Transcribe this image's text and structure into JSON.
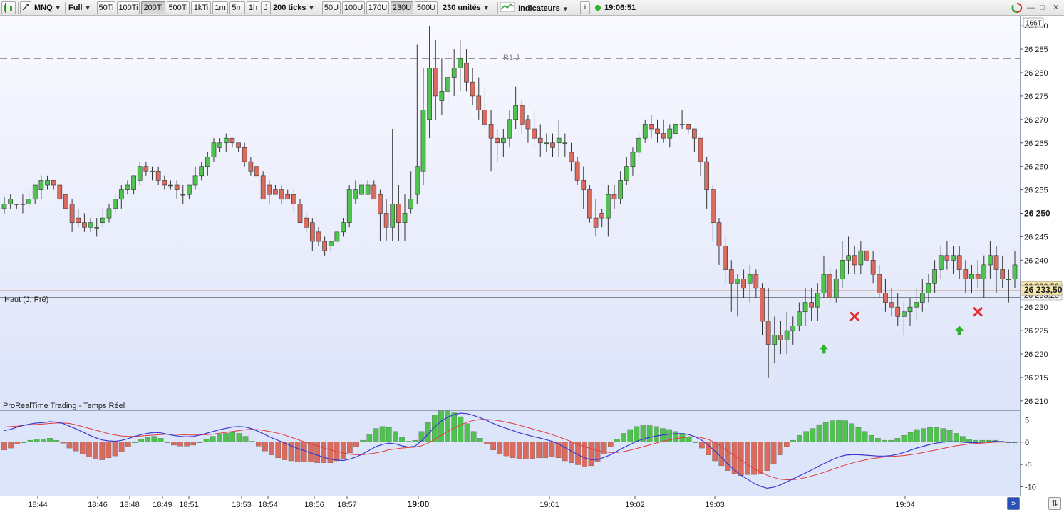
{
  "toolbar": {
    "symbol": "MNQ",
    "period_mode": "Full",
    "tick_buttons": [
      "50Ti",
      "100Ti",
      "200Ti",
      "500Ti",
      "1kTi",
      "1m",
      "5m",
      "1h",
      "J"
    ],
    "tick_active_index": 2,
    "tick_select": "200 ticks",
    "unit_buttons": [
      "50U",
      "100U",
      "170U",
      "230U",
      "500U"
    ],
    "unit_active_index": 3,
    "unit_select": "230 unités",
    "indicators_label": "Indicateurs",
    "info_label": "i",
    "clock": "19:06:51",
    "window_buttons": [
      "—",
      "□",
      "✕"
    ]
  },
  "chart": {
    "tick_count_badge": "166T",
    "r1_label": "R1 J",
    "high_label": "Haut (J, Pré)",
    "current_price": "26 233,50",
    "level_label": "26 233,25",
    "level_overlap_label": "26 233,50",
    "source_label": "ProRealTime Trading - Temps Réel",
    "price_ticks": [
      "26 290",
      "26 285",
      "26 280",
      "26 275",
      "26 270",
      "26 265",
      "26 260",
      "26 255",
      "26 250",
      "26 245",
      "26 240",
      "26 235",
      "26 230",
      "26 225",
      "26 220",
      "26 215",
      "26 210"
    ],
    "price_tick_values": [
      26290,
      26285,
      26280,
      26275,
      26270,
      26265,
      26260,
      26255,
      26250,
      26245,
      26240,
      26235,
      26230,
      26225,
      26220,
      26215,
      26210
    ],
    "bold_tick": "26 250",
    "indicator_ticks": [
      "5",
      "0",
      "-5",
      "-10"
    ],
    "indicator_tick_values": [
      5,
      0,
      -5,
      -10
    ],
    "time_labels": [
      "18:44",
      "18:46",
      "18:48",
      "18:49",
      "18:51",
      "18:53",
      "18:54",
      "18:56",
      "18:57",
      "19:00",
      "19:01",
      "19:02",
      "19:03",
      "19:04"
    ],
    "bold_time": "19:00",
    "colors": {
      "up": "#4fc24f",
      "down": "#db6b5e",
      "macd": "#3a3ad0",
      "signal": "#e23b3b",
      "r1_line": "#7a7a7a",
      "high_line": "#b5734a",
      "last_line": "#1f1f1f"
    },
    "r1_value": 26283,
    "high_value": 26233.5,
    "last_value": 26232
  },
  "chart_data": {
    "type": "candlestick",
    "title": "",
    "price_range": [
      26208,
      26292
    ],
    "candles": [
      [
        26251,
        26253.5,
        26250,
        26252
      ],
      [
        26252,
        26254,
        26251,
        26253
      ],
      [
        26252,
        26252,
        26251,
        26252
      ],
      [
        26252,
        26254,
        26250,
        26252
      ],
      [
        26252,
        26255,
        26251,
        26253
      ],
      [
        26253,
        26256,
        26252,
        26256
      ],
      [
        26255,
        26258,
        26253,
        26257
      ],
      [
        26256,
        26258,
        26255,
        26257
      ],
      [
        26257,
        26257,
        26255,
        26256
      ],
      [
        26256,
        26256,
        26253,
        26253
      ],
      [
        26254,
        26254,
        26249,
        26251
      ],
      [
        26252,
        26253,
        26246,
        26248
      ],
      [
        26249,
        26251,
        26247,
        26248
      ],
      [
        26248,
        26250,
        26246,
        26247
      ],
      [
        26247,
        26249,
        26246,
        26248
      ],
      [
        26247,
        26249,
        26245,
        26247
      ],
      [
        26248,
        26251,
        26247,
        26249
      ],
      [
        26249,
        26252,
        26248,
        26251
      ],
      [
        26251,
        26254,
        26250,
        26253
      ],
      [
        26253,
        26256,
        26251,
        26255
      ],
      [
        26255,
        26257,
        26254,
        26256
      ],
      [
        26255,
        26258,
        26254,
        26258
      ],
      [
        26257,
        26261,
        26256,
        26260
      ],
      [
        26260,
        26261,
        26258,
        26259
      ],
      [
        26259,
        26260,
        26257,
        26259
      ],
      [
        26259,
        26260,
        26256,
        26257
      ],
      [
        26257,
        26258,
        26255,
        26256
      ],
      [
        26256,
        26257,
        26255,
        26256
      ],
      [
        26256,
        26257,
        26253,
        26255
      ],
      [
        26254,
        26256,
        26252,
        26254
      ],
      [
        26254,
        26256,
        26253,
        26256
      ],
      [
        26256,
        26260,
        26255,
        26258
      ],
      [
        26258,
        26261,
        26257,
        26260
      ],
      [
        26260,
        26263,
        26258,
        26262
      ],
      [
        26262,
        26266,
        26261,
        26265
      ],
      [
        26264,
        26266,
        26263,
        26265
      ],
      [
        26265,
        26267,
        26263,
        26266
      ],
      [
        26266,
        26266,
        26264,
        26265
      ],
      [
        26265,
        26265,
        26263,
        26264
      ],
      [
        26264,
        26265,
        26260,
        26261
      ],
      [
        26261,
        26262,
        26258,
        26259
      ],
      [
        26260,
        26262,
        26257,
        26258
      ],
      [
        26258,
        26259,
        26253,
        26253
      ],
      [
        26256,
        26257,
        26252,
        26254
      ],
      [
        26255,
        26256,
        26254,
        26254
      ],
      [
        26255,
        26256,
        26252,
        26253
      ],
      [
        26254,
        26255,
        26253,
        26253
      ],
      [
        26254,
        26255,
        26250,
        26252
      ],
      [
        26252,
        26253,
        26248,
        26248
      ],
      [
        26249,
        26250,
        26246,
        26247
      ],
      [
        26248,
        26249,
        26242,
        26244
      ],
      [
        26246,
        26247,
        26243,
        26244
      ],
      [
        26244,
        26245,
        26241,
        26242
      ],
      [
        26243,
        26244,
        26242,
        26244
      ],
      [
        26244,
        26246,
        26244,
        26246
      ],
      [
        26246,
        26249,
        26245,
        26248
      ],
      [
        26248,
        26256,
        26247,
        26255
      ],
      [
        26253,
        26257,
        26252,
        26255
      ],
      [
        26254,
        26256,
        26254,
        26256
      ],
      [
        26254,
        26257,
        26254,
        26256
      ],
      [
        26256,
        26257,
        26253,
        26253
      ],
      [
        26254,
        26255,
        26244,
        26250
      ],
      [
        26250,
        26253,
        26244,
        26247
      ],
      [
        26247,
        26268,
        26244,
        26252
      ],
      [
        26252,
        26256,
        26244,
        26248
      ],
      [
        26248,
        26254,
        26244,
        26250
      ],
      [
        26251,
        26259,
        26250,
        26253
      ],
      [
        26254,
        26286,
        26252,
        26260
      ],
      [
        26259,
        26281,
        26256,
        26272
      ],
      [
        26270,
        26290,
        26266,
        26281
      ],
      [
        26281,
        26287,
        26270,
        26275
      ],
      [
        26274,
        26283,
        26271,
        26276
      ],
      [
        26276,
        26285,
        26273,
        26279
      ],
      [
        26279,
        26285,
        26275,
        26281
      ],
      [
        26281,
        26287,
        26276,
        26283
      ],
      [
        26282,
        26285,
        26276,
        26278
      ],
      [
        26278,
        26281,
        26273,
        26275
      ],
      [
        26275,
        26279,
        26270,
        26272
      ],
      [
        26272,
        26277,
        26268,
        26269
      ],
      [
        26269,
        26272,
        26259,
        26266
      ],
      [
        26266,
        26268,
        26261,
        26265
      ],
      [
        26265,
        26268,
        26262,
        26266
      ],
      [
        26266,
        26272,
        26264,
        26270
      ],
      [
        26270,
        26277,
        26268,
        26273
      ],
      [
        26273,
        26274,
        26267,
        26269
      ],
      [
        26270,
        26271,
        26265,
        26268
      ],
      [
        26268,
        26272,
        26264,
        26266
      ],
      [
        26266,
        26269,
        26262,
        26265
      ],
      [
        26265,
        26267,
        26263,
        26265
      ],
      [
        26265,
        26267,
        26262,
        26264
      ],
      [
        26265,
        26270,
        26262,
        26266
      ],
      [
        26265,
        26267,
        26262,
        26265
      ],
      [
        26263,
        26265,
        26259,
        26261
      ],
      [
        26261,
        26262,
        26256,
        26257
      ],
      [
        26257,
        26260,
        26251,
        26255
      ],
      [
        26255,
        26256,
        26248,
        26249
      ],
      [
        26249,
        26253,
        26245,
        26247
      ],
      [
        26250,
        26251,
        26247,
        26249
      ],
      [
        26249,
        26256,
        26245,
        26254
      ],
      [
        26254,
        26256,
        26251,
        26253
      ],
      [
        26253,
        26259,
        26252,
        26257
      ],
      [
        26257,
        26262,
        26256,
        26260
      ],
      [
        26260,
        26264,
        26258,
        26263
      ],
      [
        26263,
        26267,
        26262,
        26266
      ],
      [
        26266,
        26270,
        26265,
        26269
      ],
      [
        26269,
        26271,
        26266,
        26268
      ],
      [
        26268,
        26270,
        26265,
        26267
      ],
      [
        26267,
        26270,
        26265,
        26266
      ],
      [
        26266,
        26269,
        26264,
        26268
      ],
      [
        26267,
        26270,
        26266,
        26269
      ],
      [
        26269,
        26272,
        26268,
        26269
      ],
      [
        26269,
        26269,
        26267,
        26268
      ],
      [
        26268,
        26268,
        26263,
        26266
      ],
      [
        26266,
        26266,
        26258,
        26261
      ],
      [
        26261,
        26262,
        26251,
        26255
      ],
      [
        26255,
        26256,
        26244,
        26248
      ],
      [
        26248,
        26249,
        26239,
        26243
      ],
      [
        26243,
        26245,
        26235,
        26238
      ],
      [
        26238,
        26240,
        26229,
        26235
      ],
      [
        26235,
        26237,
        26228,
        26236
      ],
      [
        26236,
        26238,
        26232,
        26234
      ],
      [
        26235,
        26239,
        26231,
        26237
      ],
      [
        26237,
        26238,
        26232,
        26234
      ],
      [
        26234,
        26235,
        26224,
        26227
      ],
      [
        26227,
        26234,
        26215,
        26222
      ],
      [
        26222,
        26228,
        26218,
        26224
      ],
      [
        26224,
        26227,
        26220,
        26223
      ],
      [
        26223,
        26229,
        26220,
        26225
      ],
      [
        26225,
        26228,
        26222,
        26226
      ],
      [
        26226,
        26231,
        26225,
        26229
      ],
      [
        26229,
        26234,
        26226,
        26231
      ],
      [
        26231,
        26234,
        26227,
        26230
      ],
      [
        26230,
        26235,
        26227,
        26233
      ],
      [
        26233,
        26241,
        26232,
        26237
      ],
      [
        26237,
        26238,
        26231,
        26232
      ],
      [
        26232,
        26238,
        26231,
        26236
      ],
      [
        26236,
        26244,
        26234,
        26240
      ],
      [
        26240,
        26245,
        26237,
        26241
      ],
      [
        26241,
        26243,
        26237,
        26239
      ],
      [
        26239,
        26244,
        26237,
        26242
      ],
      [
        26242,
        26245,
        26238,
        26240
      ],
      [
        26240,
        26242,
        26235,
        26237
      ],
      [
        26237,
        26239,
        26232,
        26233
      ],
      [
        26233,
        26236,
        26229,
        26231
      ],
      [
        26231,
        26234,
        26228,
        26230
      ],
      [
        26230,
        26233,
        26226,
        26228
      ],
      [
        26228,
        26231,
        26224,
        26229
      ],
      [
        26229,
        26232,
        26226,
        26230
      ],
      [
        26230,
        26234,
        26227,
        26231
      ],
      [
        26231,
        26236,
        26229,
        26233
      ],
      [
        26233,
        26237,
        26231,
        26235
      ],
      [
        26235,
        26240,
        26233,
        26238
      ],
      [
        26238,
        26243,
        26236,
        26241
      ],
      [
        26241,
        26244,
        26238,
        26240
      ],
      [
        26240,
        26243,
        26237,
        26241
      ],
      [
        26241,
        26243,
        26236,
        26238
      ],
      [
        26238,
        26240,
        26233,
        26236
      ],
      [
        26236,
        26239,
        26233,
        26237
      ],
      [
        26237,
        26240,
        26234,
        26236
      ],
      [
        26236,
        26241,
        26232,
        26239
      ],
      [
        26239,
        26244,
        26236,
        26241
      ],
      [
        26241,
        26243,
        26233,
        26238
      ],
      [
        26238,
        26241,
        26234,
        26236
      ],
      [
        26236,
        26238,
        26231,
        26236
      ],
      [
        26236,
        26242,
        26234,
        26239
      ]
    ],
    "signals": [
      {
        "type": "buy-arrow",
        "index": 133,
        "price": 26221
      },
      {
        "type": "exit-cross",
        "index": 138,
        "price": 26228
      },
      {
        "type": "buy-arrow",
        "index": 155,
        "price": 26225
      },
      {
        "type": "exit-cross",
        "index": 158,
        "price": 26229
      }
    ],
    "indicator": {
      "range": [
        -12,
        7
      ],
      "macd": [
        2.6,
        2.9,
        3.4,
        3.8,
        4.1,
        4.3,
        4.4,
        4.6,
        4.5,
        4.2,
        3.6,
        3.0,
        2.3,
        1.6,
        1.0,
        0.5,
        0.3,
        0.2,
        0.4,
        0.8,
        1.3,
        1.7,
        2.0,
        2.2,
        2.1,
        1.8,
        1.5,
        1.3,
        1.2,
        1.3,
        1.6,
        2.0,
        2.4,
        2.8,
        3.1,
        3.4,
        3.5,
        3.4,
        3.0,
        2.4,
        1.7,
        1.0,
        0.4,
        -0.2,
        -0.8,
        -1.4,
        -1.9,
        -2.4,
        -2.9,
        -3.4,
        -3.8,
        -4.0,
        -4.1,
        -3.8,
        -3.3,
        -2.6,
        -1.8,
        -1.0,
        -0.5,
        -0.2,
        -0.4,
        -0.8,
        -1.1,
        -0.9,
        0.3,
        1.8,
        3.4,
        4.7,
        5.6,
        6.2,
        6.5,
        6.4,
        6.0,
        5.5,
        4.9,
        4.2,
        3.6,
        3.1,
        2.6,
        2.1,
        1.7,
        1.3,
        1.0,
        0.6,
        0.2,
        -0.4,
        -1.2,
        -2.0,
        -2.8,
        -3.5,
        -3.9,
        -3.9,
        -3.4,
        -2.8,
        -2.0,
        -1.2,
        -0.5,
        0.2,
        0.7,
        1.1,
        1.4,
        1.6,
        1.8,
        1.9,
        1.9,
        1.7,
        1.2,
        0.4,
        -0.7,
        -2.0,
        -3.4,
        -4.9,
        -6.2,
        -7.4,
        -8.3,
        -9.2,
        -9.9,
        -10.3,
        -10.1,
        -9.6,
        -8.9,
        -8.2,
        -7.5,
        -6.8,
        -6.1,
        -5.3,
        -4.6,
        -3.9,
        -3.3,
        -2.9,
        -2.8,
        -2.8,
        -2.9,
        -3.0,
        -3.1,
        -3.1,
        -3.0,
        -2.7,
        -2.3,
        -1.8,
        -1.3,
        -0.9,
        -0.5,
        -0.2,
        0.0,
        0.1,
        0.1,
        0.0,
        -0.1,
        -0.1,
        0.0,
        0.1,
        0.2,
        0.1,
        0.0,
        0.0
      ],
      "signal": [
        3.4,
        3.5,
        3.6,
        3.8,
        3.9,
        4.0,
        4.1,
        4.2,
        4.3,
        4.3,
        4.2,
        3.9,
        3.5,
        3.1,
        2.7,
        2.3,
        1.9,
        1.6,
        1.4,
        1.3,
        1.3,
        1.4,
        1.5,
        1.6,
        1.7,
        1.8,
        1.8,
        1.7,
        1.6,
        1.6,
        1.6,
        1.7,
        1.8,
        2.0,
        2.2,
        2.4,
        2.6,
        2.8,
        2.9,
        2.8,
        2.6,
        2.3,
        2.0,
        1.6,
        1.1,
        0.6,
        0.1,
        -0.4,
        -0.8,
        -1.3,
        -1.7,
        -2.1,
        -2.4,
        -2.7,
        -2.8,
        -2.8,
        -2.6,
        -2.4,
        -2.1,
        -1.7,
        -1.5,
        -1.3,
        -1.2,
        -1.1,
        -0.8,
        -0.2,
        0.6,
        1.5,
        2.4,
        3.2,
        3.9,
        4.5,
        4.9,
        5.1,
        5.1,
        5.0,
        4.8,
        4.5,
        4.2,
        3.8,
        3.4,
        3.0,
        2.6,
        2.2,
        1.7,
        1.2,
        0.7,
        0.1,
        -0.5,
        -1.0,
        -1.5,
        -1.9,
        -2.2,
        -2.3,
        -2.3,
        -2.1,
        -1.8,
        -1.4,
        -1.0,
        -0.6,
        -0.2,
        0.2,
        0.5,
        0.8,
        1.0,
        1.2,
        1.2,
        1.0,
        0.6,
        -0.1,
        -1.0,
        -2.0,
        -3.0,
        -4.0,
        -5.0,
        -5.9,
        -6.7,
        -7.4,
        -7.9,
        -8.3,
        -8.4,
        -8.4,
        -8.2,
        -7.9,
        -7.5,
        -7.1,
        -6.6,
        -6.1,
        -5.6,
        -5.1,
        -4.7,
        -4.3,
        -4.0,
        -3.7,
        -3.5,
        -3.3,
        -3.2,
        -3.1,
        -3.0,
        -2.8,
        -2.6,
        -2.3,
        -2.0,
        -1.7,
        -1.4,
        -1.1,
        -0.8,
        -0.6,
        -0.4,
        -0.3,
        -0.2,
        -0.1,
        0.0,
        0.0,
        0.0,
        0.0
      ]
    }
  }
}
